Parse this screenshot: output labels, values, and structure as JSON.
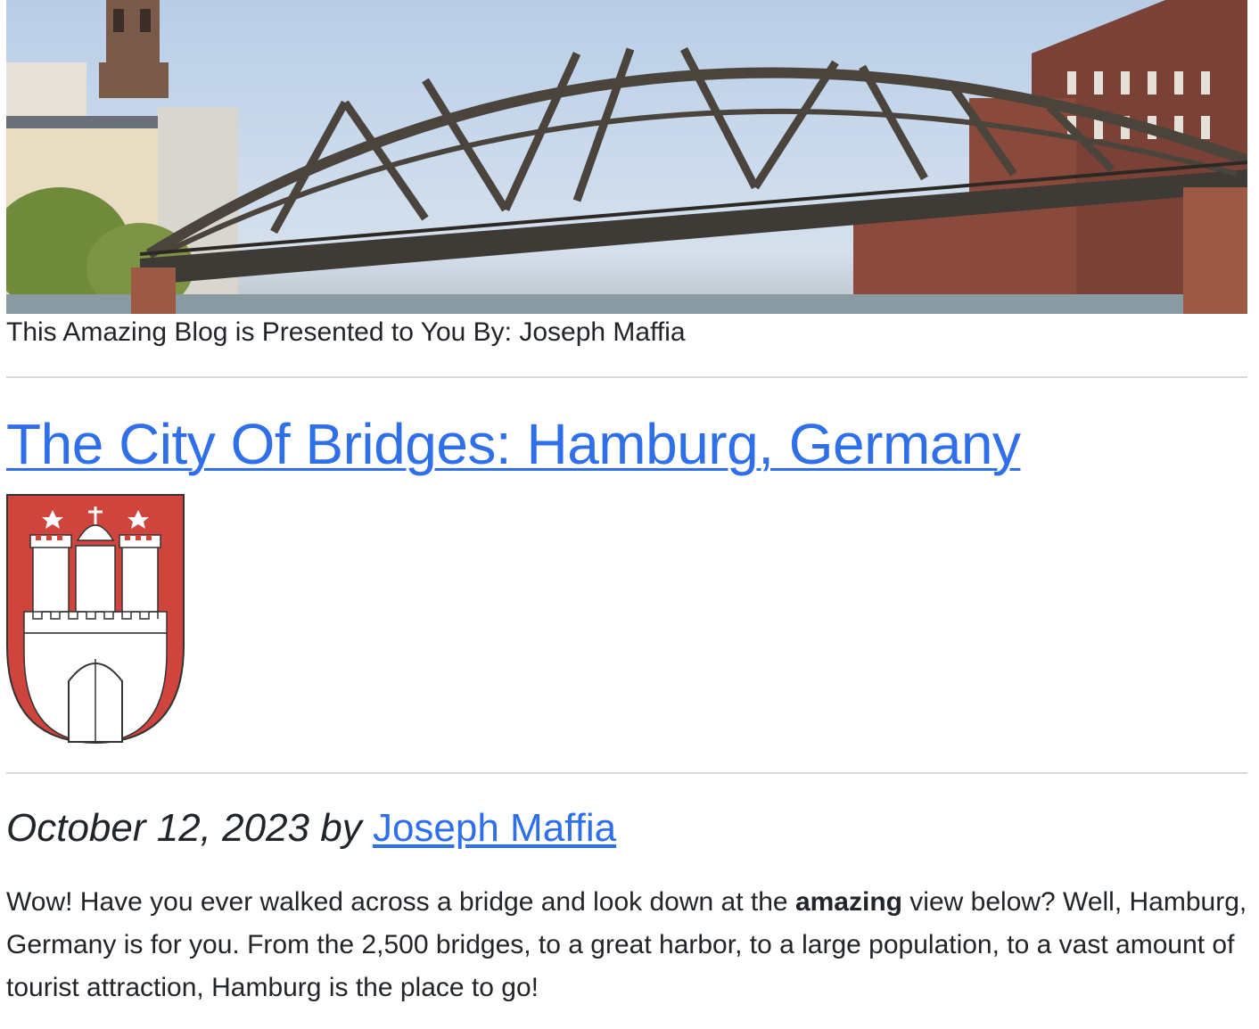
{
  "header": {
    "hero_image_alt": "Hamburg bridge photo",
    "byline": "This Amazing Blog is Presented to You By: Joseph Maffia"
  },
  "post": {
    "title": "The City Of Bridges: Hamburg, Germany",
    "crest_alt": "Hamburg coat of arms",
    "date_by": "October 12, 2023 by ",
    "author": "Joseph Maffia",
    "body": {
      "part1": "Wow! Have you ever walked across a bridge and look down at the ",
      "bold": "amazing",
      "part2": " view below? Well, Hamburg, Germany is for you. From the 2,500 bridges, to a great harbor, to a large population, to a vast amount of tourist attraction, Hamburg is the place to go!"
    }
  },
  "colors": {
    "link": "#2f6fea",
    "text": "#212529",
    "crest_red": "#d0443e",
    "rule": "#d9d9d9"
  }
}
